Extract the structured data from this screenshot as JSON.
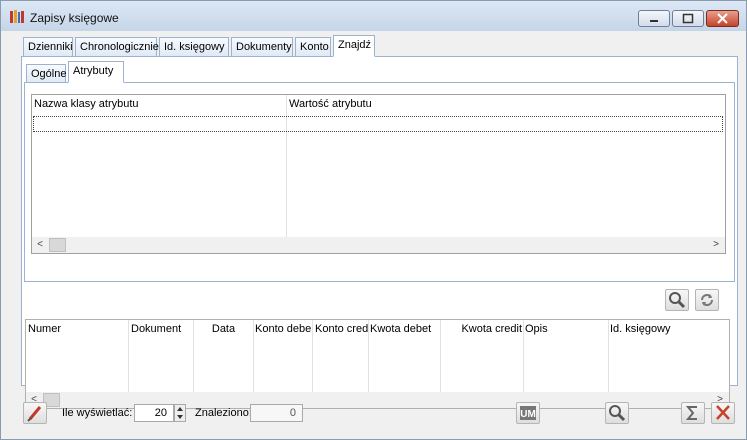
{
  "window": {
    "title": "Zapisy księgowe"
  },
  "main_tabs": [
    "Dzienniki",
    "Chronologicznie",
    "Id. księgowy",
    "Dokumenty",
    "Konto",
    "Znajdź"
  ],
  "main_tabs_active": "Znajdź",
  "sub_tabs": [
    "Ogólne",
    "Atrybuty"
  ],
  "sub_tabs_active": "Atrybuty",
  "attributes_grid": {
    "columns": [
      "Nazwa klasy atrybutu",
      "Wartość atrybutu"
    ],
    "rows": []
  },
  "results_grid": {
    "columns": [
      "Numer",
      "Dokument",
      "Data",
      "Konto debe",
      "Konto cred",
      "Kwota debet",
      "Kwota credit",
      "Opis",
      "Id. księgowy"
    ],
    "rows": []
  },
  "footer": {
    "show_label": "Ile wyświetlać:",
    "show_value": "20",
    "found_label": "Znaleziono:",
    "found_value": "0"
  },
  "colors": {
    "accent": "#9bb3cf",
    "close": "#c5432b"
  }
}
